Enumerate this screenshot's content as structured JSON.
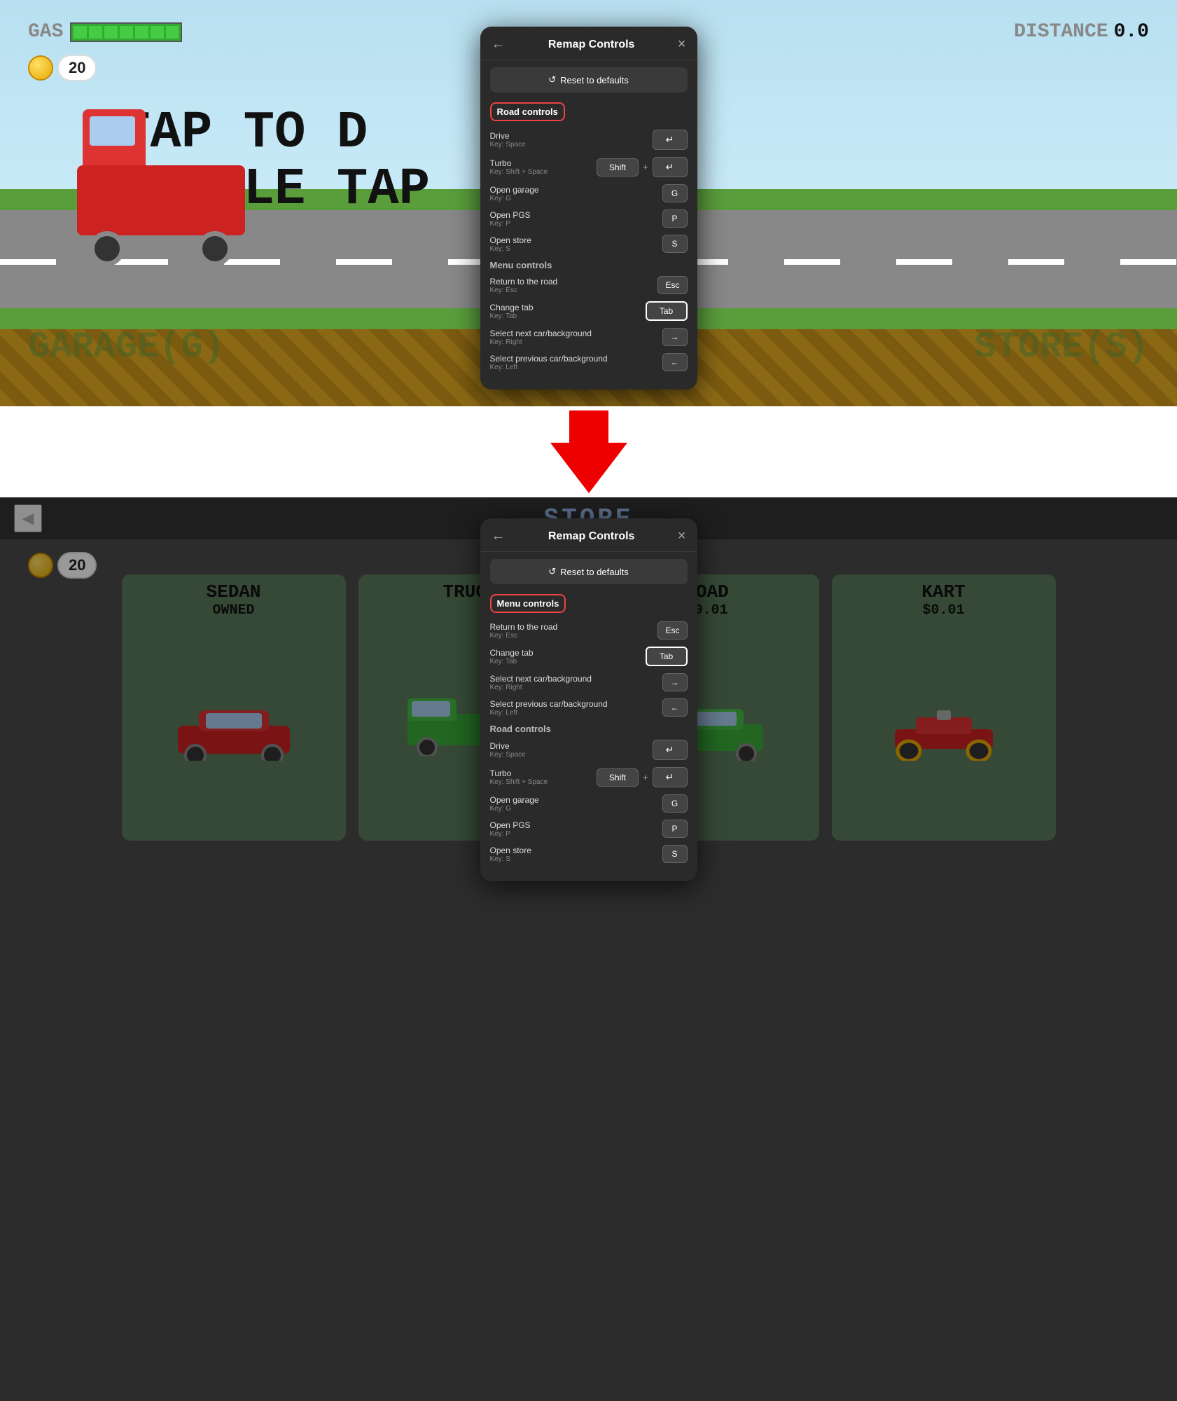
{
  "top_hud": {
    "gas_label": "GAS",
    "gas_segments": 7,
    "distance_label": "DISTANCE",
    "distance_value": "0.0",
    "coin_count": "20"
  },
  "game_text": {
    "tap_line1": "TAP TO D",
    "tap_line2": "DOUBLE TAP"
  },
  "labels": {
    "garage": "GARAGE(G)",
    "store": "STORE(S)",
    "store_header": "STORE"
  },
  "modal_top": {
    "title": "Remap Controls",
    "back_label": "←",
    "close_label": "×",
    "reset_label": "Reset to defaults",
    "reset_icon": "↺",
    "road_controls_label": "Road controls",
    "menu_controls_label": "Menu controls",
    "controls": [
      {
        "section": "road",
        "name": "Drive",
        "key_hint": "Key: Space",
        "keys": [
          "↵"
        ],
        "combo": false
      },
      {
        "section": "road",
        "name": "Turbo",
        "key_hint": "Key: Shift + Space",
        "keys": [
          "Shift",
          "↵"
        ],
        "combo": true
      },
      {
        "section": "road",
        "name": "Open garage",
        "key_hint": "Key: G",
        "keys": [
          "G"
        ],
        "combo": false
      },
      {
        "section": "road",
        "name": "Open PGS",
        "key_hint": "Key: P",
        "keys": [
          "P"
        ],
        "combo": false
      },
      {
        "section": "road",
        "name": "Open store",
        "key_hint": "Key: S",
        "keys": [
          "S"
        ],
        "combo": false
      },
      {
        "section": "menu",
        "name": "Return to the road",
        "key_hint": "Key: Esc",
        "keys": [
          "Esc"
        ],
        "combo": false
      },
      {
        "section": "menu",
        "name": "Change tab",
        "key_hint": "Key: Tab",
        "keys": [
          "Tab"
        ],
        "combo": false,
        "active": true
      },
      {
        "section": "menu",
        "name": "Select next car/background",
        "key_hint": "Key: Right",
        "keys": [
          "→"
        ],
        "combo": false
      },
      {
        "section": "menu",
        "name": "Select previous car/background",
        "key_hint": "Key: Left",
        "keys": [
          "←"
        ],
        "combo": false
      }
    ]
  },
  "modal_bottom": {
    "title": "Remap Controls",
    "back_label": "←",
    "close_label": "×",
    "reset_label": "Reset to defaults",
    "reset_icon": "↺",
    "road_controls_label": "Road controls",
    "menu_controls_label": "Menu controls",
    "controls": [
      {
        "section": "menu",
        "name": "Return to the road",
        "key_hint": "Key: Esc",
        "keys": [
          "Esc"
        ],
        "combo": false
      },
      {
        "section": "menu",
        "name": "Change tab",
        "key_hint": "Key: Tab",
        "keys": [
          "Tab"
        ],
        "combo": false,
        "active": true
      },
      {
        "section": "menu",
        "name": "Select next car/background",
        "key_hint": "Key: Right",
        "keys": [
          "→"
        ],
        "combo": false
      },
      {
        "section": "menu",
        "name": "Select previous car/background",
        "key_hint": "Key: Left",
        "keys": [
          "←"
        ],
        "combo": false
      },
      {
        "section": "road",
        "name": "Drive",
        "key_hint": "Key: Space",
        "keys": [
          "↵"
        ],
        "combo": false
      },
      {
        "section": "road",
        "name": "Turbo",
        "key_hint": "Key: Shift + Space",
        "keys": [
          "Shift",
          "↵"
        ],
        "combo": true
      },
      {
        "section": "road",
        "name": "Open garage",
        "key_hint": "Key: G",
        "keys": [
          "G"
        ],
        "combo": false
      },
      {
        "section": "road",
        "name": "Open PGS",
        "key_hint": "Key: P",
        "keys": [
          "P"
        ],
        "combo": false
      },
      {
        "section": "road",
        "name": "Open store",
        "key_hint": "Key: S",
        "keys": [
          "S"
        ],
        "combo": false
      }
    ]
  },
  "car_cards": [
    {
      "name": "SEDAN",
      "sub": "OWNED",
      "color": "#5a7a5a"
    },
    {
      "name": "TRUCK",
      "sub": "",
      "color": "#5a7a5a"
    },
    {
      "name": "ROAD",
      "sub": "$0.01",
      "color": "#5a7a5a"
    },
    {
      "name": "KART",
      "sub": "$0.01",
      "color": "#5a7a5a"
    }
  ],
  "bottom_coin": "20"
}
